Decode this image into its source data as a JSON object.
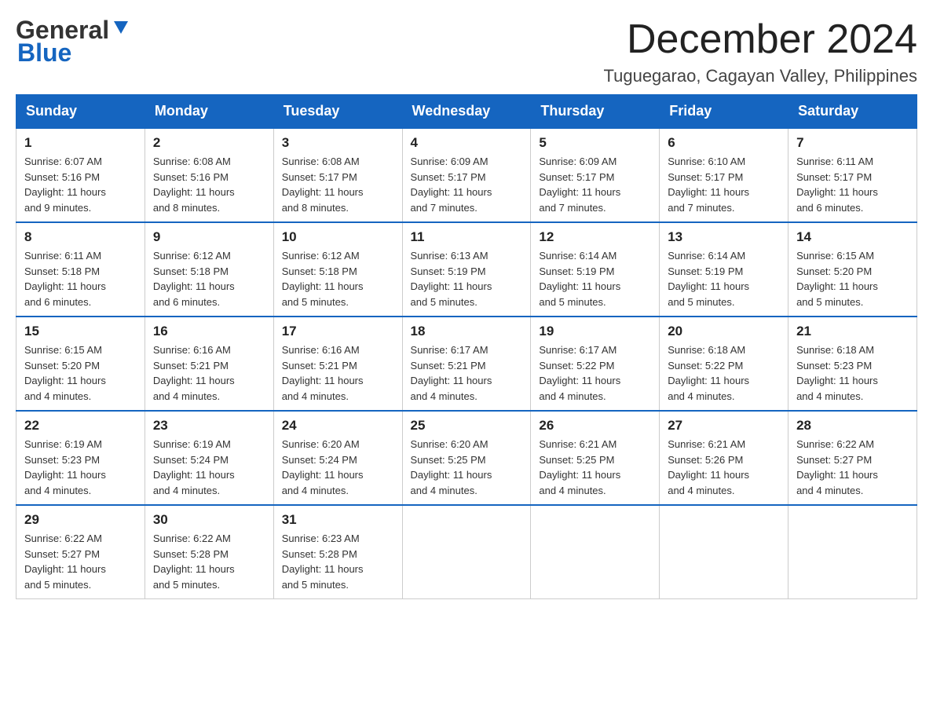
{
  "header": {
    "logo_general": "General",
    "logo_blue": "Blue",
    "month_title": "December 2024",
    "location": "Tuguegarao, Cagayan Valley, Philippines"
  },
  "weekdays": [
    "Sunday",
    "Monday",
    "Tuesday",
    "Wednesday",
    "Thursday",
    "Friday",
    "Saturday"
  ],
  "weeks": [
    [
      {
        "day": "1",
        "sunrise": "6:07 AM",
        "sunset": "5:16 PM",
        "daylight": "11 hours and 9 minutes."
      },
      {
        "day": "2",
        "sunrise": "6:08 AM",
        "sunset": "5:16 PM",
        "daylight": "11 hours and 8 minutes."
      },
      {
        "day": "3",
        "sunrise": "6:08 AM",
        "sunset": "5:17 PM",
        "daylight": "11 hours and 8 minutes."
      },
      {
        "day": "4",
        "sunrise": "6:09 AM",
        "sunset": "5:17 PM",
        "daylight": "11 hours and 7 minutes."
      },
      {
        "day": "5",
        "sunrise": "6:09 AM",
        "sunset": "5:17 PM",
        "daylight": "11 hours and 7 minutes."
      },
      {
        "day": "6",
        "sunrise": "6:10 AM",
        "sunset": "5:17 PM",
        "daylight": "11 hours and 7 minutes."
      },
      {
        "day": "7",
        "sunrise": "6:11 AM",
        "sunset": "5:17 PM",
        "daylight": "11 hours and 6 minutes."
      }
    ],
    [
      {
        "day": "8",
        "sunrise": "6:11 AM",
        "sunset": "5:18 PM",
        "daylight": "11 hours and 6 minutes."
      },
      {
        "day": "9",
        "sunrise": "6:12 AM",
        "sunset": "5:18 PM",
        "daylight": "11 hours and 6 minutes."
      },
      {
        "day": "10",
        "sunrise": "6:12 AM",
        "sunset": "5:18 PM",
        "daylight": "11 hours and 5 minutes."
      },
      {
        "day": "11",
        "sunrise": "6:13 AM",
        "sunset": "5:19 PM",
        "daylight": "11 hours and 5 minutes."
      },
      {
        "day": "12",
        "sunrise": "6:14 AM",
        "sunset": "5:19 PM",
        "daylight": "11 hours and 5 minutes."
      },
      {
        "day": "13",
        "sunrise": "6:14 AM",
        "sunset": "5:19 PM",
        "daylight": "11 hours and 5 minutes."
      },
      {
        "day": "14",
        "sunrise": "6:15 AM",
        "sunset": "5:20 PM",
        "daylight": "11 hours and 5 minutes."
      }
    ],
    [
      {
        "day": "15",
        "sunrise": "6:15 AM",
        "sunset": "5:20 PM",
        "daylight": "11 hours and 4 minutes."
      },
      {
        "day": "16",
        "sunrise": "6:16 AM",
        "sunset": "5:21 PM",
        "daylight": "11 hours and 4 minutes."
      },
      {
        "day": "17",
        "sunrise": "6:16 AM",
        "sunset": "5:21 PM",
        "daylight": "11 hours and 4 minutes."
      },
      {
        "day": "18",
        "sunrise": "6:17 AM",
        "sunset": "5:21 PM",
        "daylight": "11 hours and 4 minutes."
      },
      {
        "day": "19",
        "sunrise": "6:17 AM",
        "sunset": "5:22 PM",
        "daylight": "11 hours and 4 minutes."
      },
      {
        "day": "20",
        "sunrise": "6:18 AM",
        "sunset": "5:22 PM",
        "daylight": "11 hours and 4 minutes."
      },
      {
        "day": "21",
        "sunrise": "6:18 AM",
        "sunset": "5:23 PM",
        "daylight": "11 hours and 4 minutes."
      }
    ],
    [
      {
        "day": "22",
        "sunrise": "6:19 AM",
        "sunset": "5:23 PM",
        "daylight": "11 hours and 4 minutes."
      },
      {
        "day": "23",
        "sunrise": "6:19 AM",
        "sunset": "5:24 PM",
        "daylight": "11 hours and 4 minutes."
      },
      {
        "day": "24",
        "sunrise": "6:20 AM",
        "sunset": "5:24 PM",
        "daylight": "11 hours and 4 minutes."
      },
      {
        "day": "25",
        "sunrise": "6:20 AM",
        "sunset": "5:25 PM",
        "daylight": "11 hours and 4 minutes."
      },
      {
        "day": "26",
        "sunrise": "6:21 AM",
        "sunset": "5:25 PM",
        "daylight": "11 hours and 4 minutes."
      },
      {
        "day": "27",
        "sunrise": "6:21 AM",
        "sunset": "5:26 PM",
        "daylight": "11 hours and 4 minutes."
      },
      {
        "day": "28",
        "sunrise": "6:22 AM",
        "sunset": "5:27 PM",
        "daylight": "11 hours and 4 minutes."
      }
    ],
    [
      {
        "day": "29",
        "sunrise": "6:22 AM",
        "sunset": "5:27 PM",
        "daylight": "11 hours and 5 minutes."
      },
      {
        "day": "30",
        "sunrise": "6:22 AM",
        "sunset": "5:28 PM",
        "daylight": "11 hours and 5 minutes."
      },
      {
        "day": "31",
        "sunrise": "6:23 AM",
        "sunset": "5:28 PM",
        "daylight": "11 hours and 5 minutes."
      },
      null,
      null,
      null,
      null
    ]
  ],
  "labels": {
    "sunrise_prefix": "Sunrise: ",
    "sunset_prefix": "Sunset: ",
    "daylight_prefix": "Daylight: "
  }
}
